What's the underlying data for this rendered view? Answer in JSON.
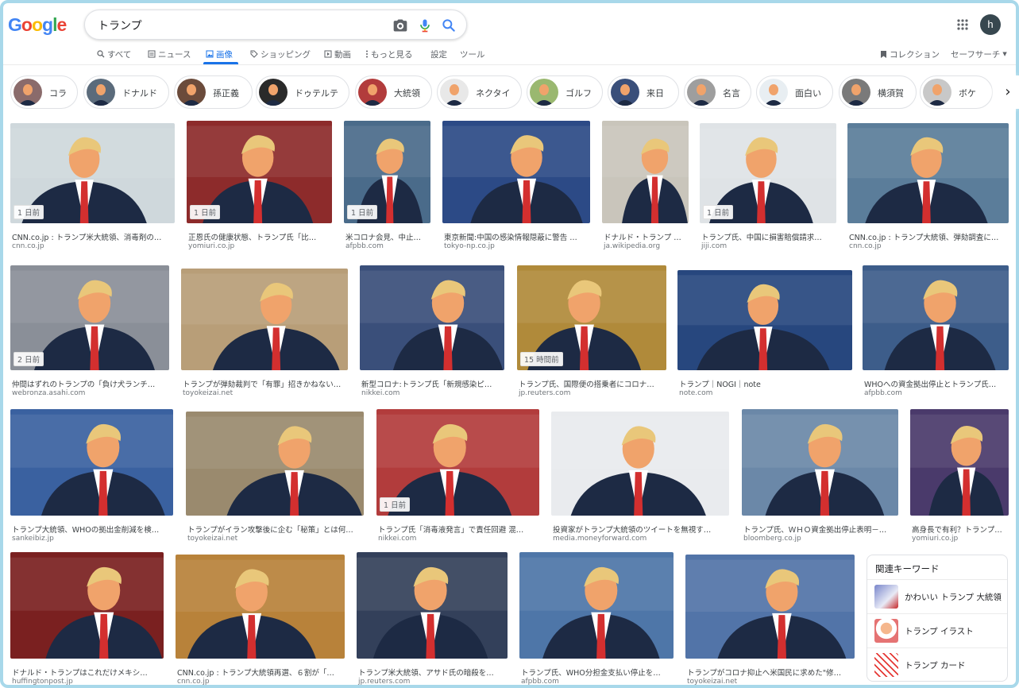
{
  "header": {
    "logo": [
      "G",
      "o",
      "o",
      "g",
      "l",
      "e"
    ],
    "logo_colors": [
      "#4285f4",
      "#ea4335",
      "#fbbc05",
      "#4285f4",
      "#34a853",
      "#ea4335"
    ],
    "search_value": "トランプ",
    "icons": [
      "camera-icon",
      "microphone-icon",
      "search-icon",
      "apps-icon"
    ],
    "avatar_letter": "h"
  },
  "tabs": [
    {
      "label": "すべて",
      "icon": "search-icon"
    },
    {
      "label": "ニュース",
      "icon": "news-icon"
    },
    {
      "label": "画像",
      "icon": "image-icon",
      "active": true
    },
    {
      "label": "ショッピング",
      "icon": "tag-icon"
    },
    {
      "label": "動画",
      "icon": "play-icon"
    },
    {
      "label": "もっと見る",
      "icon": "more-dots-icon"
    },
    {
      "label": "設定"
    },
    {
      "label": "ツール"
    }
  ],
  "right_tools": {
    "collection": "コレクション",
    "safesearch": "セーフサーチ"
  },
  "chips": [
    "コラ",
    "ドナルド",
    "孫正義",
    "ドゥテルテ",
    "大統領",
    "ネクタイ",
    "ゴルフ",
    "来日",
    "名言",
    "面白い",
    "横須賀",
    "ボケ"
  ],
  "results": [
    {
      "caption": "CNN.co.jp : トランプ米大統領、消毒剤の…",
      "domain": "cnn.co.jp",
      "badge": "1 日前"
    },
    {
      "caption": "正恩氏の健康状態、トランプ氏「比…",
      "domain": "yomiuri.co.jp",
      "badge": "1 日前"
    },
    {
      "caption": "米コロナ会見、中止…",
      "domain": "afpbb.com",
      "badge": "1 日前"
    },
    {
      "caption": "東京新聞:中国の感染情報隠蔽に警告 …",
      "domain": "tokyo-np.co.jp",
      "badge": ""
    },
    {
      "caption": "ドナルド・トランプ …",
      "domain": "ja.wikipedia.org",
      "badge": ""
    },
    {
      "caption": "トランプ氏、中国に損害賠償請求…",
      "domain": "jiji.com",
      "badge": "1 日前"
    },
    {
      "caption": "CNN.co.jp : トランプ大統領、弾劾調査に…",
      "domain": "cnn.co.jp",
      "badge": ""
    },
    {
      "caption": "仲間はずれのトランプの「負け犬ランチ…",
      "domain": "webronza.asahi.com",
      "badge": "2 日前"
    },
    {
      "caption": "トランプが弾劾裁判で「有罪」招きかねない…",
      "domain": "toyokeizai.net",
      "badge": ""
    },
    {
      "caption": "新型コロナ:トランプ氏「新規感染ピ…",
      "domain": "nikkei.com",
      "badge": ""
    },
    {
      "caption": "トランプ氏、国際便の搭乗者にコロナ…",
      "domain": "jp.reuters.com",
      "badge": "15 時間前"
    },
    {
      "caption": "トランプ｜NOGI｜note",
      "domain": "note.com",
      "badge": ""
    },
    {
      "caption": "WHOへの資金拠出停止とトランプ氏…",
      "domain": "afpbb.com",
      "badge": ""
    },
    {
      "caption": "トランプ大統領、WHOの拠出金削減を検…",
      "domain": "sankeibiz.jp",
      "badge": ""
    },
    {
      "caption": "トランプがイラン攻撃後に企む「秘策」とは何…",
      "domain": "toyokeizai.net",
      "badge": ""
    },
    {
      "caption": "トランプ氏「消毒液発言」で責任回避 混…",
      "domain": "nikkei.com",
      "badge": "1 日前"
    },
    {
      "caption": "投資家がトランプ大統領のツイートを無視す…",
      "domain": "media.moneyforward.com",
      "badge": ""
    },
    {
      "caption": "トランプ氏、ＷＨＯ資金拠出停止表明－…",
      "domain": "bloomberg.co.jp",
      "badge": ""
    },
    {
      "caption": "高身長で有利？トランプ…",
      "domain": "yomiuri.co.jp",
      "badge": ""
    },
    {
      "caption": "ドナルド・トランプはこれだけメキシ…",
      "domain": "huffingtonpost.jp",
      "badge": ""
    },
    {
      "caption": "CNN.co.jp : トランプ大統領再選、６割が「…",
      "domain": "cnn.co.jp",
      "badge": ""
    },
    {
      "caption": "トランプ米大統領、アサド氏の暗殺を…",
      "domain": "jp.reuters.com",
      "badge": ""
    },
    {
      "caption": "トランプ氏、WHO分担金支払い停止を…",
      "domain": "afpbb.com",
      "badge": ""
    },
    {
      "caption": "トランプがコロナ抑止へ米国民に求めた\"修…",
      "domain": "toyokeizai.net",
      "badge": ""
    }
  ],
  "related": {
    "title": "関連キーワード",
    "items": [
      "かわいい トランプ 大統領",
      "トランプ イラスト",
      "トランプ カード"
    ]
  }
}
